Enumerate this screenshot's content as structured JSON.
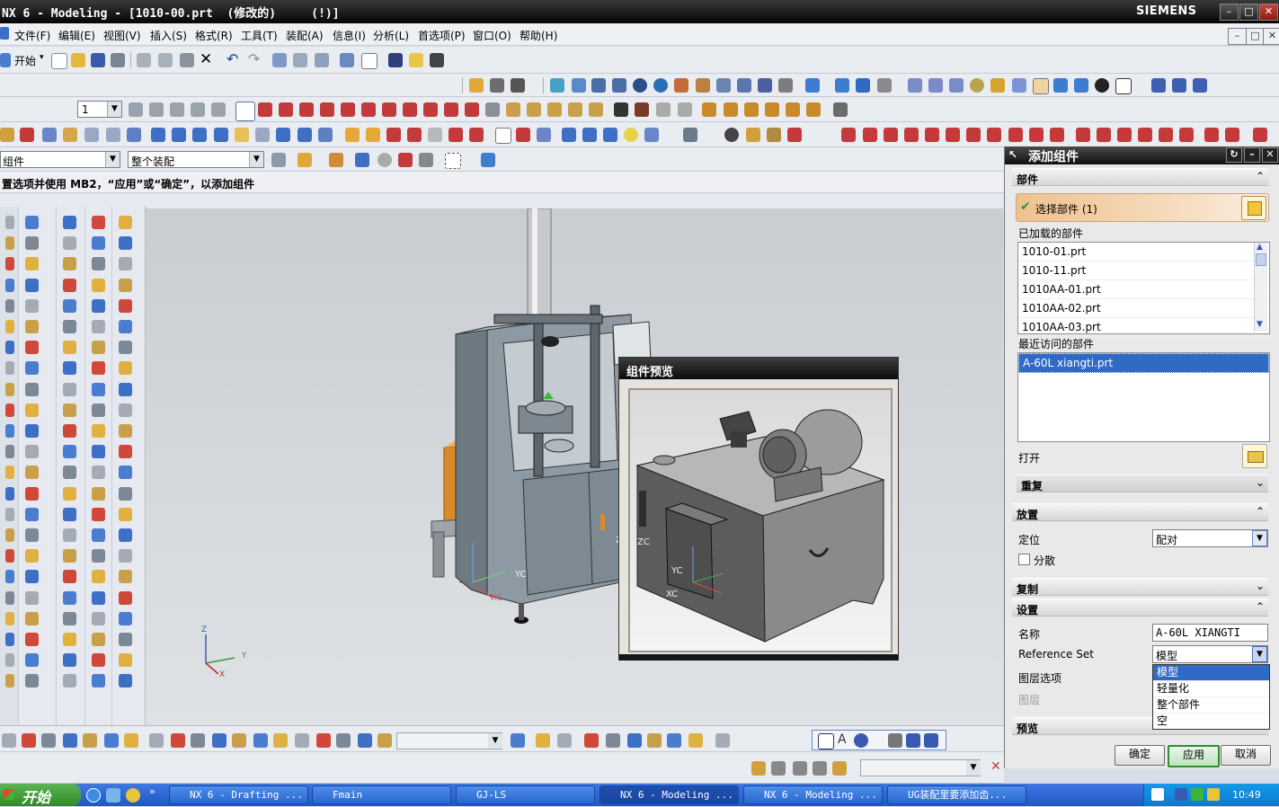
{
  "window": {
    "title": "NX 6 - Modeling - [1010-00.prt  (修改的)     (!)]",
    "brand": "SIEMENS",
    "controls": [
      "–",
      "□",
      "✕"
    ]
  },
  "menu": [
    "文件(F)",
    "编辑(E)",
    "视图(V)",
    "插入(S)",
    "格式(R)",
    "工具(T)",
    "装配(A)",
    "信息(I)",
    "分析(L)",
    "首选项(P)",
    "窗口(O)",
    "帮助(H)"
  ],
  "toolbar": {
    "start_label": "开始",
    "layer_value": "1",
    "filter_type": "组件",
    "filter_scope": "整个装配"
  },
  "cue_line": "置选项并使用 MB2，“应用”或“确定”，以添加组件",
  "viewport": {
    "axis_labels": {
      "z": "Z",
      "y": "Y",
      "x": "X"
    },
    "model_axis_labels": {
      "zc": "ZC",
      "yc": "YC",
      "xc": "XC"
    }
  },
  "preview": {
    "title": "组件预览",
    "axis_labels": {
      "zc": "ZC",
      "yc": "YC",
      "xc": "XC"
    }
  },
  "dialog": {
    "title": "添加组件",
    "section_part": "部件",
    "select_part": "选择部件 (1)",
    "loaded_parts_label": "已加载的部件",
    "loaded_parts": [
      "1010-01.prt",
      "1010-11.prt",
      "1010AA-01.prt",
      "1010AA-02.prt",
      "1010AA-03.prt"
    ],
    "recent_parts_label": "最近访问的部件",
    "recent_parts": [
      "A-60L xiangti.prt"
    ],
    "open_label": "打开",
    "repeat_label": "重复",
    "section_placement": "放置",
    "positioning_label": "定位",
    "positioning_value": "配对",
    "scatter_label": "分散",
    "section_copy": "复制",
    "section_settings": "设置",
    "name_label": "名称",
    "name_value": "A-60L XIANGTI",
    "refset_label": "Reference Set",
    "refset_value": "模型",
    "refset_options": [
      "模型",
      "轻量化",
      "整个部件",
      "空"
    ],
    "layer_option_label": "图层选项",
    "layer_label": "图层",
    "section_preview": "预览",
    "ok_label": "确定",
    "apply_label": "应用",
    "cancel_label": "取消"
  },
  "taskbar": {
    "start_label": "开始",
    "tasks": [
      "NX 6 - Drafting ...",
      "Fmain",
      "GJ-LS",
      "NX 6 - Modeling ...",
      "NX 6 - Modeling ...",
      "UG装配里要添加齿..."
    ],
    "clock": "10:49"
  },
  "colors": {
    "title_bar": "#0d0d0d",
    "selection_highlight": "#f2c79a",
    "list_selection": "#316ac5",
    "taskbar": "#2a66d0",
    "start_button": "#3a9a34",
    "apply_border": "#2d8f2d"
  }
}
